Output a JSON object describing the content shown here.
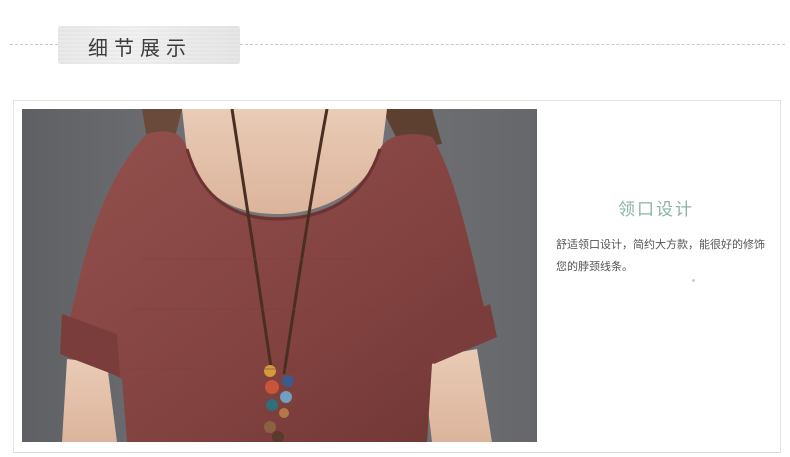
{
  "section": {
    "title": "细节展示"
  },
  "feature": {
    "title": "领口设计",
    "description": "舒适领口设计，简约大方款，能很好的修饰您的脖颈线条。"
  },
  "photo": {
    "subject": "red linen short-sleeve top with beaded necklace"
  },
  "colors": {
    "accent": "#8bb3a5",
    "shirt": "#8a4a48",
    "background": "#6e6f73"
  }
}
